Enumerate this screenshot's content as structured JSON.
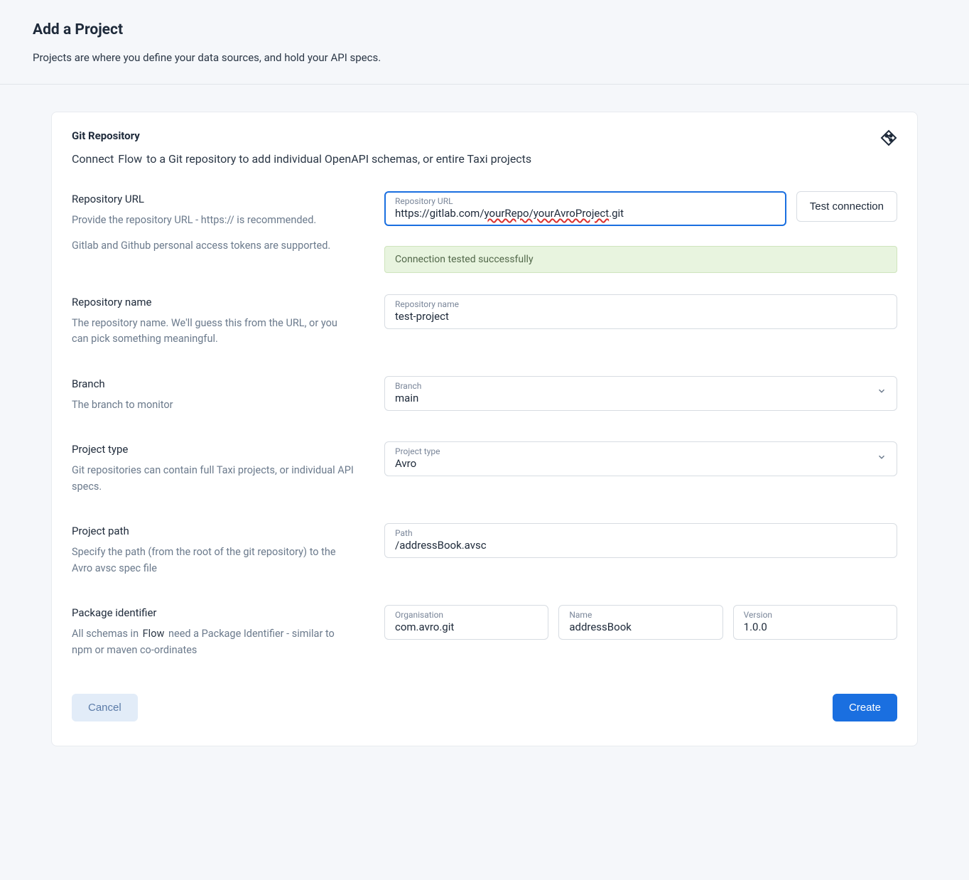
{
  "header": {
    "title": "Add a Project",
    "subtitle": "Projects are where you define your data sources, and hold your API specs."
  },
  "card": {
    "title": "Git Repository",
    "connect_pre": "Connect ",
    "connect_chip": "Flow",
    "connect_post": " to a Git repository to add individual OpenAPI schemas, or entire Taxi projects"
  },
  "repoUrl": {
    "label": "Repository URL",
    "desc1": "Provide the repository URL - https:// is recommended.",
    "desc2": "Gitlab and Github personal access tokens are supported.",
    "float": "Repository URL",
    "value_pre": "https://gitlab.com/",
    "value_squiggle": "yourRepo/yourAvroProject",
    "value_post": ".git",
    "testBtn": "Test connection",
    "status": "Connection tested successfully"
  },
  "repoName": {
    "label": "Repository name",
    "desc": "The repository name. We'll guess this from the URL, or you can pick something meaningful.",
    "float": "Repository name",
    "value": "test-project"
  },
  "branch": {
    "label": "Branch",
    "desc": "The branch to monitor",
    "float": "Branch",
    "value": "main"
  },
  "projectType": {
    "label": "Project type",
    "desc": "Git repositories can contain full Taxi projects, or individual API specs.",
    "float": "Project type",
    "value": "Avro"
  },
  "projectPath": {
    "label": "Project path",
    "desc": "Specify the path (from the root of the git repository) to the Avro avsc spec file",
    "float": "Path",
    "value": "/addressBook.avsc"
  },
  "packageId": {
    "label": "Package identifier",
    "desc_pre": "All schemas in ",
    "desc_chip": "Flow",
    "desc_post": " need a Package Identifier - similar to npm or maven co-ordinates",
    "org_float": "Organisation",
    "org_value": "com.avro.git",
    "name_float": "Name",
    "name_value": "addressBook",
    "ver_float": "Version",
    "ver_value": "1.0.0"
  },
  "footer": {
    "cancel": "Cancel",
    "create": "Create"
  }
}
